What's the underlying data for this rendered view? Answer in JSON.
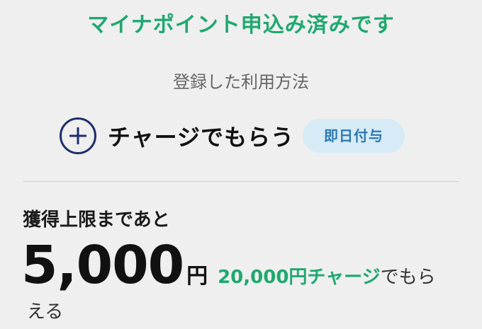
{
  "status": {
    "title": "マイナポイント申込み済みです"
  },
  "method": {
    "caption": "登録した利用方法",
    "label": "チャージでもらう",
    "badge": "即日付与"
  },
  "remaining": {
    "label": "獲得上限まであと",
    "amount": "5,000",
    "unit": "円",
    "note_charge": "20,000円チャージ",
    "note_rest_line1": "でもら",
    "note_rest_line2": "える"
  },
  "colors": {
    "accent_green": "#1fa870",
    "icon_navy": "#1d2f6b",
    "badge_bg": "#d6ebf6",
    "badge_text": "#2a78b3"
  }
}
